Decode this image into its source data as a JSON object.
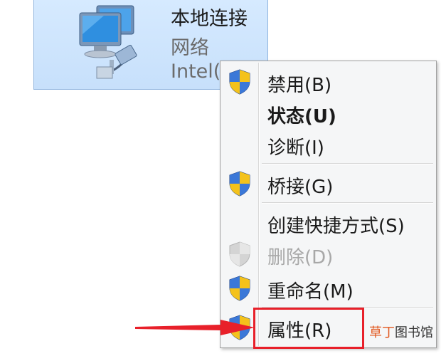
{
  "connection": {
    "name": "本地连接",
    "type": "网络",
    "device": "Intel(R)"
  },
  "menu": {
    "items": [
      {
        "label": "禁用(B)",
        "icon": "uac-shield-icon"
      },
      {
        "label": "状态(U)",
        "bold": true
      },
      {
        "label": "诊断(I)"
      },
      {
        "label": "桥接(G)",
        "icon": "uac-shield-icon"
      },
      {
        "label": "创建快捷方式(S)"
      },
      {
        "label": "删除(D)",
        "icon": "uac-shield-disabled-icon",
        "disabled": true
      },
      {
        "label": "重命名(M)",
        "icon": "uac-shield-icon"
      },
      {
        "label": "属性(R)",
        "icon": "uac-shield-icon",
        "highlighted": true
      }
    ]
  },
  "watermark": {
    "part1": "草丁",
    "part2": "图书馆"
  },
  "colors": {
    "highlight_border": "#e8202a",
    "tile_bg": "#d6eaff",
    "menu_bg": "#f5f6f7",
    "watermark_accent": "#e25a22"
  }
}
